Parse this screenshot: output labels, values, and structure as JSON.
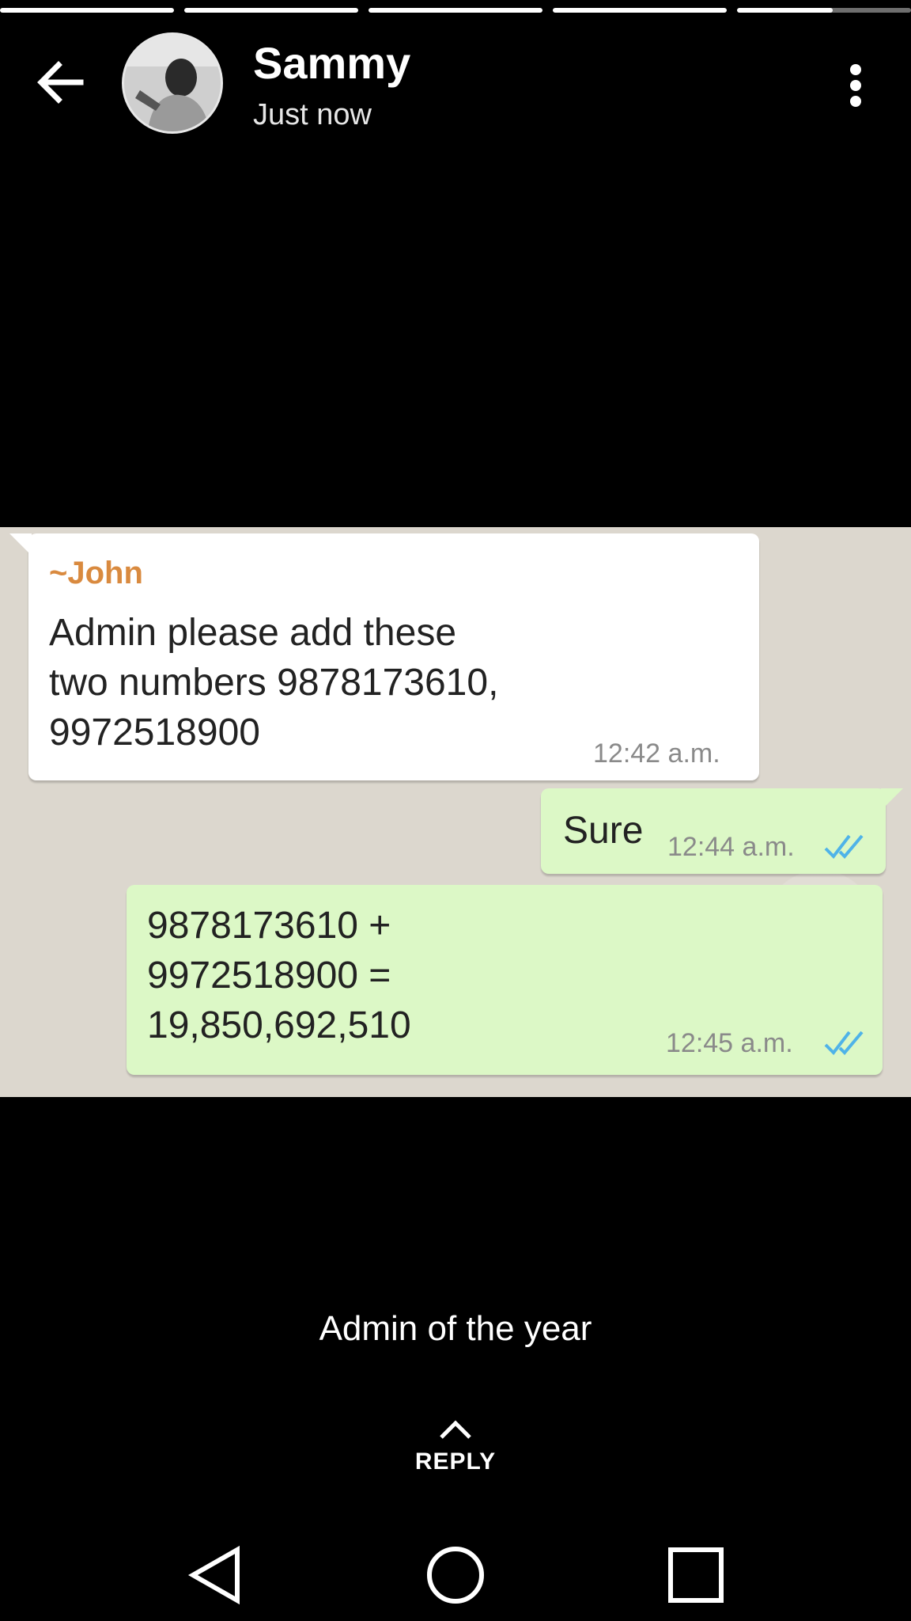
{
  "story": {
    "progress_segments": [
      1,
      1,
      1,
      1,
      0.55
    ]
  },
  "header": {
    "back_icon": "arrow-left-icon",
    "avatar": "user-avatar",
    "name": "Sammy",
    "time": "Just now",
    "more_icon": "more-vertical-icon"
  },
  "chat": {
    "messages": [
      {
        "direction": "incoming",
        "sender": "~John",
        "text": "Admin please add these\ntwo numbers 9878173610,\n9972518900",
        "time": "12:42 a.m."
      },
      {
        "direction": "outgoing",
        "text": "Sure",
        "time": "12:44 a.m.",
        "status": "read-double-tick"
      },
      {
        "direction": "outgoing",
        "text": "9878173610 +\n9972518900 =\n19,850,692,510",
        "time": "12:45 a.m.",
        "status": "read-double-tick"
      }
    ],
    "colors": {
      "incoming": "#ffffff",
      "outgoing": "#dcf8c6",
      "sender": "#d98a3f",
      "tick": "#4fb3e8"
    }
  },
  "caption": "Admin of the year",
  "reply": {
    "label": "REPLY",
    "icon": "chevron-up-icon"
  },
  "navbar": {
    "back_icon": "nav-back-triangle-icon",
    "home_icon": "nav-home-circle-icon",
    "recents_icon": "nav-recents-square-icon"
  }
}
